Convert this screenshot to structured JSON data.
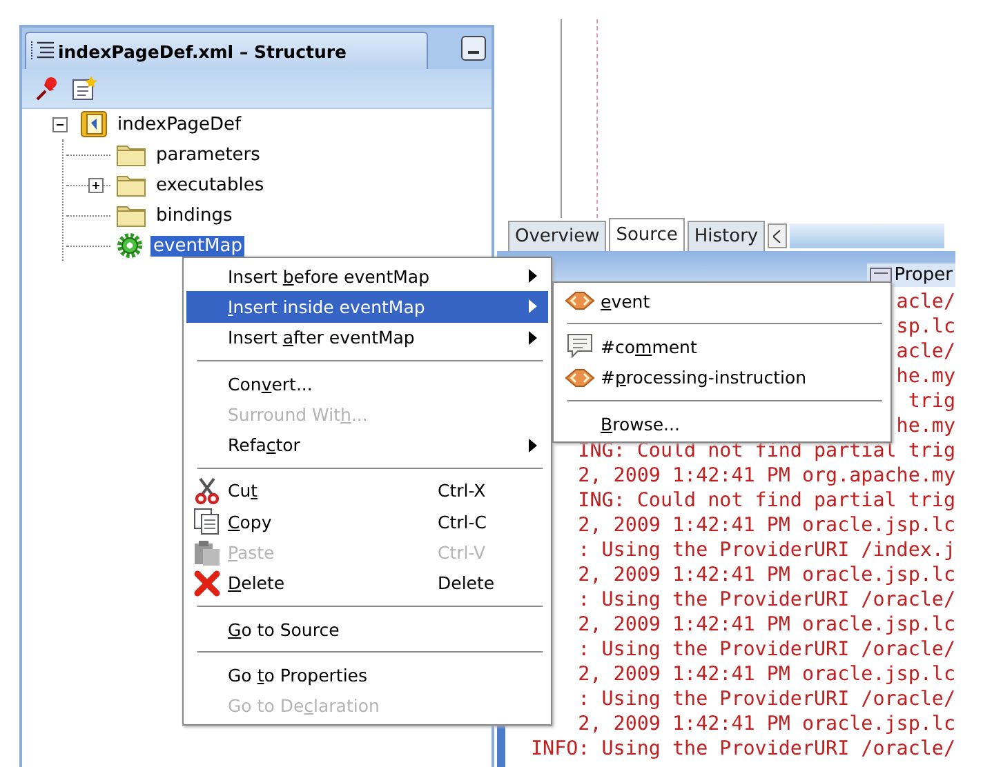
{
  "structure_panel": {
    "title": "indexPageDef.xml – Structure",
    "tree": [
      {
        "label": "indexPageDef",
        "expanded": true,
        "selected": false,
        "children": [
          {
            "label": "parameters",
            "selected": false
          },
          {
            "label": "executables",
            "expanded": false,
            "selected": false
          },
          {
            "label": "bindings",
            "selected": false
          },
          {
            "label": "eventMap",
            "selected": true
          }
        ]
      }
    ]
  },
  "editor_tabs": [
    {
      "label": "Overview",
      "selected": false
    },
    {
      "label": "Source",
      "selected": true
    },
    {
      "label": "History",
      "selected": false
    }
  ],
  "log_panel": {
    "tab": "Proper",
    "lines": [
      "acle/",
      "sp.lc",
      "acle/",
      "he.my",
      "trig",
      "he.my",
      "ING: Could not find partial trig",
      "2, 2009 1:42:41 PM org.apache.my",
      "ING: Could not find partial trig",
      "2, 2009 1:42:41 PM oracle.jsp.lc",
      ": Using the ProviderURI /index.j",
      "2, 2009 1:42:41 PM oracle.jsp.lc",
      ": Using the ProviderURI /oracle/",
      "2, 2009 1:42:41 PM oracle.jsp.lc",
      ": Using the ProviderURI /oracle/",
      "2, 2009 1:42:41 PM oracle.jsp.lc",
      ": Using the ProviderURI /oracle/",
      "2, 2009 1:42:41 PM oracle.jsp.lc",
      "INFO: Using the ProviderURI /oracle/"
    ]
  },
  "context_menu": [
    {
      "kind": "submenu",
      "pre": "Insert ",
      "key": "b",
      "post": "efore eventMap",
      "selected": false,
      "disabled": false
    },
    {
      "kind": "submenu",
      "key": "I",
      "post": "nsert inside eventMap",
      "selected": true,
      "disabled": false
    },
    {
      "kind": "submenu",
      "pre": "Insert ",
      "key": "a",
      "post": "fter eventMap",
      "selected": false,
      "disabled": false
    },
    {
      "kind": "separator"
    },
    {
      "kind": "command",
      "pre": "Con",
      "key": "v",
      "post": "ert...",
      "selected": false,
      "disabled": false
    },
    {
      "kind": "command",
      "pre": "Surround Wit",
      "key": "h",
      "post": "...",
      "selected": false,
      "disabled": true
    },
    {
      "kind": "submenu",
      "pre": "Refa",
      "key": "c",
      "post": "tor",
      "selected": false,
      "disabled": false
    },
    {
      "kind": "separator"
    },
    {
      "kind": "command",
      "pre": "Cu",
      "key": "t",
      "shortcut": "Ctrl-X",
      "selected": false,
      "disabled": false
    },
    {
      "kind": "command",
      "key": "C",
      "post": "opy",
      "shortcut": "Ctrl-C",
      "selected": false,
      "disabled": false
    },
    {
      "kind": "command",
      "key": "P",
      "post": "aste",
      "shortcut": "Ctrl-V",
      "selected": false,
      "disabled": true
    },
    {
      "kind": "command",
      "key": "D",
      "post": "elete",
      "shortcut": "Delete",
      "selected": false,
      "disabled": false
    },
    {
      "kind": "separator"
    },
    {
      "kind": "command",
      "key": "G",
      "post": "o to Source",
      "selected": false,
      "disabled": false
    },
    {
      "kind": "separator"
    },
    {
      "kind": "command",
      "pre": "Go ",
      "key": "t",
      "post": "o Properties",
      "selected": false,
      "disabled": false
    },
    {
      "kind": "command",
      "pre": "Go to De",
      "key": "c",
      "post": "laration",
      "selected": false,
      "disabled": true
    }
  ],
  "submenu": [
    {
      "kind": "command",
      "key": "e",
      "post": "vent",
      "selected": false
    },
    {
      "kind": "separator"
    },
    {
      "kind": "command",
      "pre": "#co",
      "key": "m",
      "post": "ment",
      "selected": false
    },
    {
      "kind": "command",
      "pre": "#",
      "key": "p",
      "post": "rocessing-instruction",
      "selected": false
    },
    {
      "kind": "separator"
    },
    {
      "kind": "command",
      "key": "B",
      "post": "rowse...",
      "selected": false
    }
  ]
}
